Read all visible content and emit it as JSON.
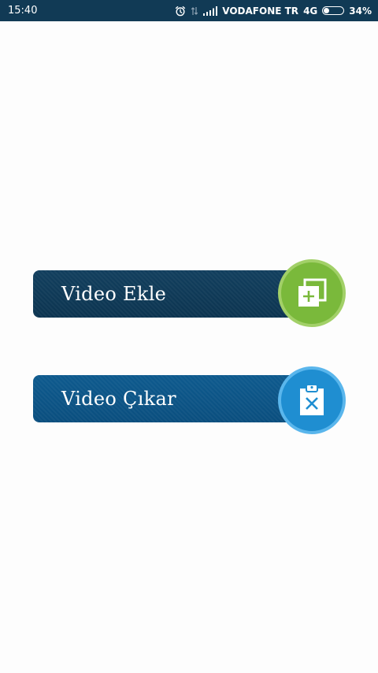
{
  "status_bar": {
    "time": "15:40",
    "carrier": "VODAFONE TR",
    "network": "4G",
    "battery_percent_text": "34%",
    "battery_level": 0.34,
    "background_color": "#113a55",
    "icons": [
      "alarm-icon",
      "data-transfer-icon",
      "signal-icon",
      "battery-icon"
    ]
  },
  "actions": {
    "add_video": {
      "label": "Video Ekle",
      "icon": "add-copy-icon",
      "pill_color": "#0f3a58",
      "circle_color": "#7ab93b"
    },
    "remove_video": {
      "label": "Video Çıkar",
      "icon": "clipboard-remove-icon",
      "pill_color": "#0b5385",
      "circle_color": "#1f8ed1"
    }
  }
}
